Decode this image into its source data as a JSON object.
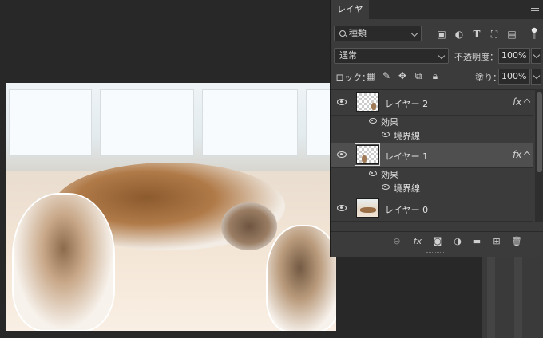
{
  "panel": {
    "tab_label": "レイヤー",
    "menu_icon": "hamburger-icon"
  },
  "filter": {
    "kind_label": "種類",
    "icons": [
      "image-filter-icon",
      "adjustment-filter-icon",
      "type-filter-icon",
      "shape-filter-icon",
      "smart-object-filter-icon",
      "filter-toggle-icon"
    ]
  },
  "blend": {
    "mode": "通常",
    "opacity_label": "不透明度：",
    "opacity_value": "100%"
  },
  "lock": {
    "label": "ロック：",
    "icons": [
      "lock-transparent-icon",
      "lock-image-icon",
      "lock-position-icon",
      "lock-artboard-icon",
      "lock-all-icon"
    ],
    "fill_label": "塗り：",
    "fill_value": "100%"
  },
  "layers": [
    {
      "name": "レイヤー 2",
      "selected": false,
      "fx": "fx",
      "effects_label": "効果",
      "effect_items": [
        "境界線"
      ]
    },
    {
      "name": "レイヤー 1",
      "selected": true,
      "fx": "fx",
      "effects_label": "効果",
      "effect_items": [
        "境界線"
      ]
    },
    {
      "name": "レイヤー 0",
      "selected": false
    }
  ],
  "footer": {
    "icons": [
      "link-layers-icon",
      "add-layer-style-icon",
      "add-mask-icon",
      "new-adjustment-layer-icon",
      "new-group-icon",
      "new-layer-icon",
      "delete-layer-icon"
    ],
    "fx_label": "fx"
  }
}
